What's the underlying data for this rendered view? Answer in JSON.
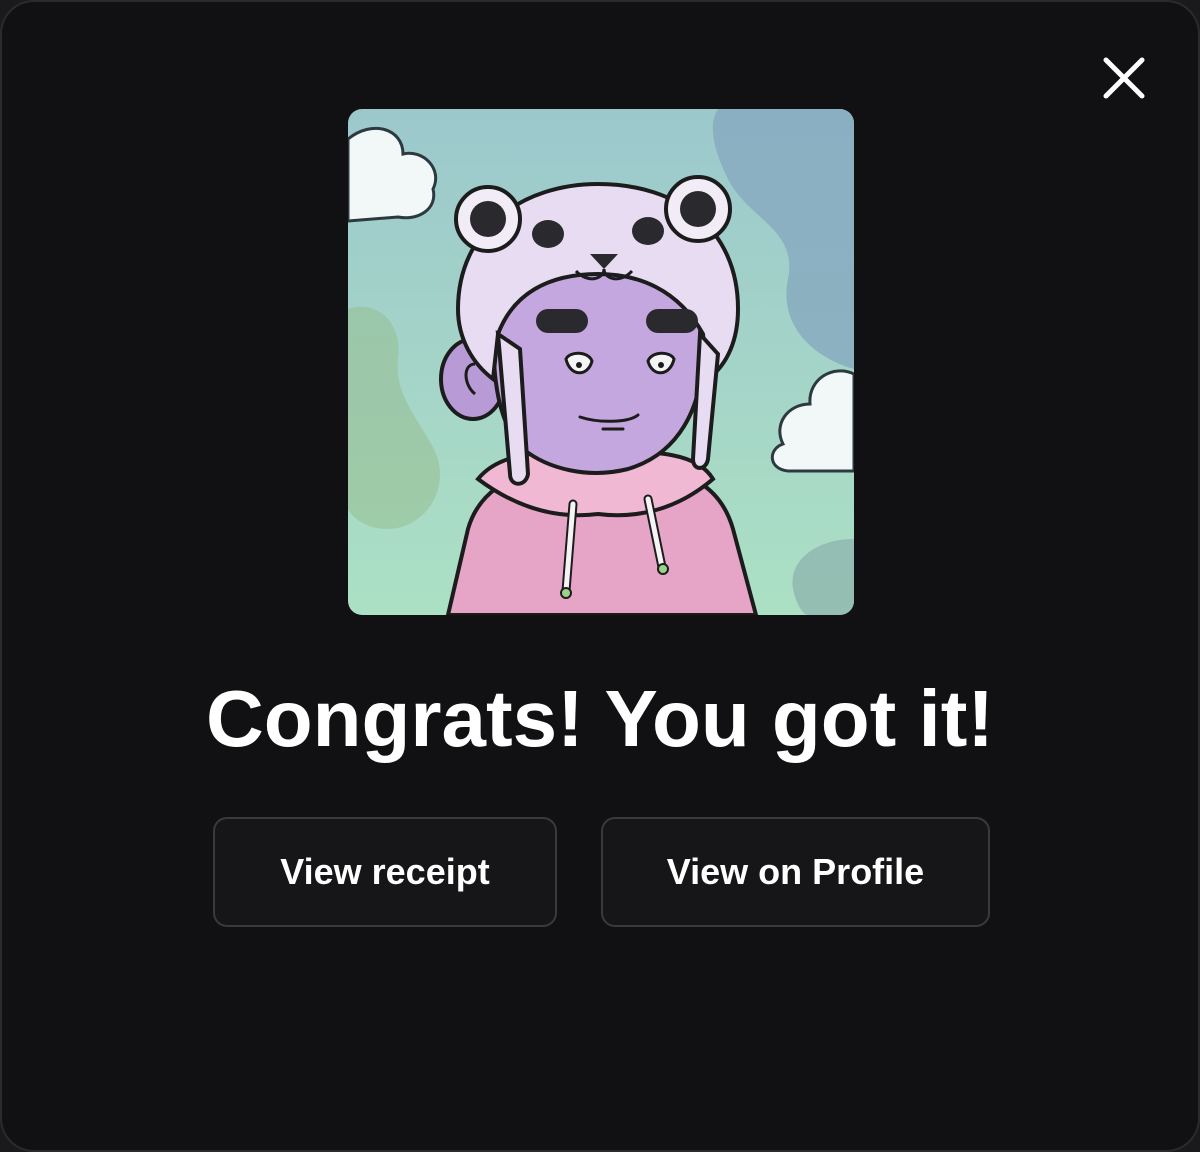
{
  "modal": {
    "title": "Congrats! You got it!",
    "close_icon": "close-icon",
    "image": {
      "subject": "cartoon character wearing a panda-ear hat and pink hoodie",
      "background_color": "#a8d8c4",
      "sky_color": "#9ec9cf"
    },
    "buttons": {
      "receipt_label": "View receipt",
      "profile_label": "View on Profile"
    }
  },
  "colors": {
    "modal_background": "#111113",
    "text": "#ffffff",
    "button_border": "#3a3a3e"
  }
}
